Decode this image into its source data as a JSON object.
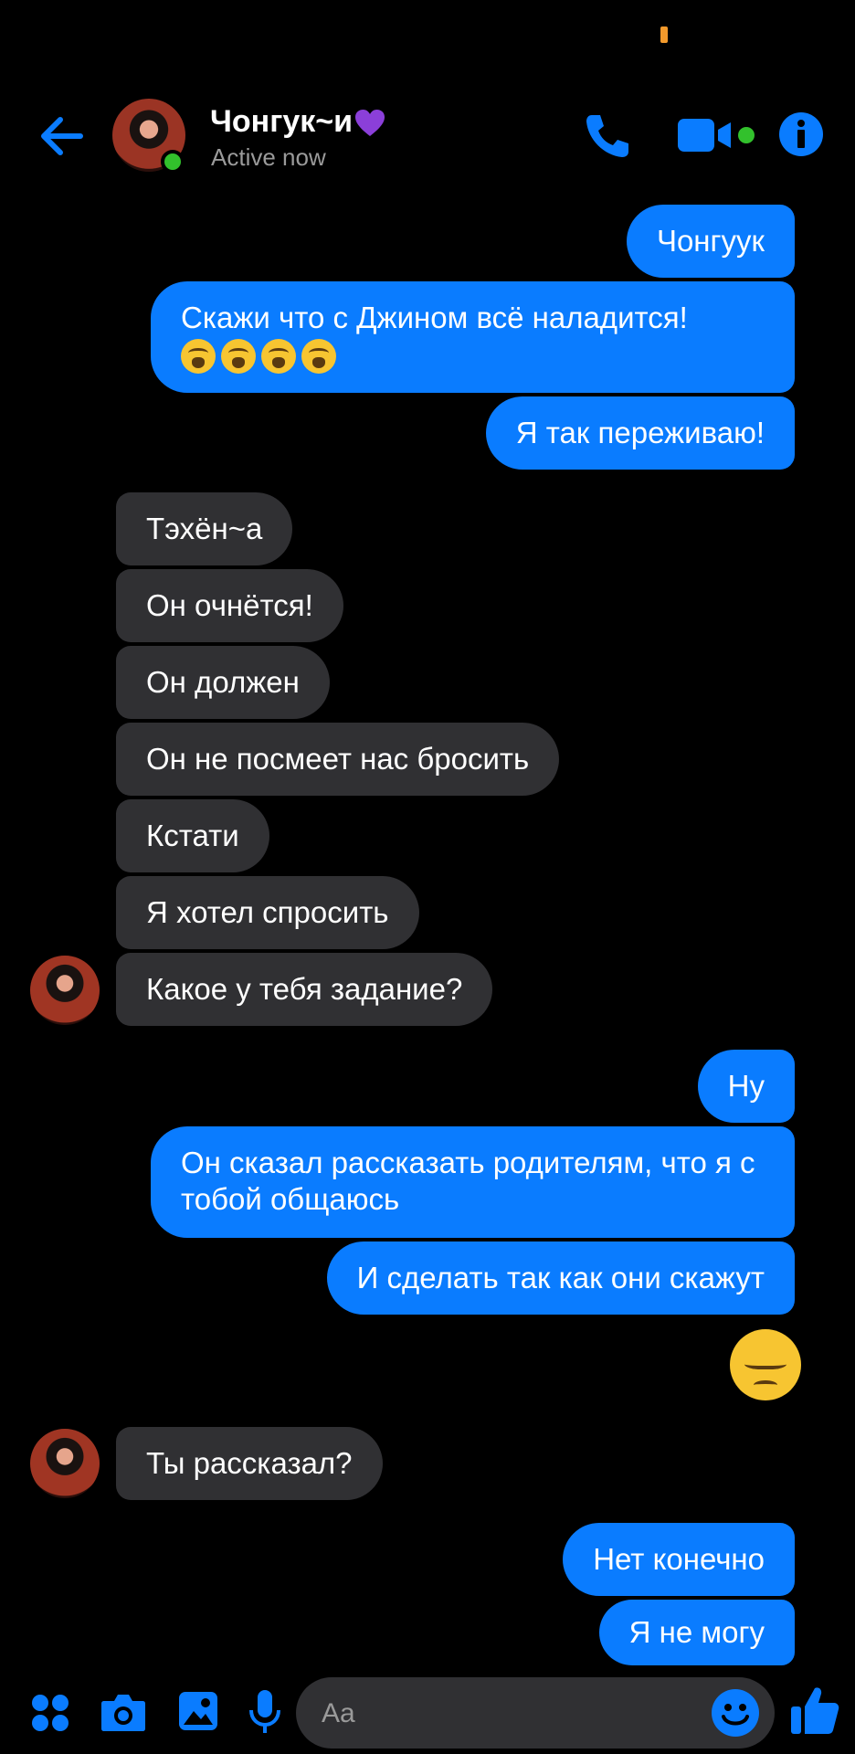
{
  "header": {
    "contact_name": "Чонгук~и",
    "status": "Active now"
  },
  "messages": [
    {
      "side": "out",
      "text": "Чонгуук"
    },
    {
      "side": "out",
      "text": "Скажи что с Джином всё наладится!"
    },
    {
      "side": "out",
      "text": "Я так переживаю!"
    },
    {
      "side": "in",
      "text": "Тэхён~а"
    },
    {
      "side": "in",
      "text": "Он очнётся!"
    },
    {
      "side": "in",
      "text": "Он должен"
    },
    {
      "side": "in",
      "text": "Он не посмеет нас бросить"
    },
    {
      "side": "in",
      "text": "Кстати"
    },
    {
      "side": "in",
      "text": "Я хотел спросить"
    },
    {
      "side": "in",
      "text": "Какое у тебя задание?"
    },
    {
      "side": "out",
      "text": "Ну"
    },
    {
      "side": "out",
      "text": "Он сказал рассказать родителям, что я с тобой общаюсь"
    },
    {
      "side": "out",
      "text": "И сделать так как они скажут"
    },
    {
      "side": "in",
      "text": "Ты рассказал?"
    },
    {
      "side": "out",
      "text": "Нет конечно"
    },
    {
      "side": "out",
      "text": "Я не могу"
    }
  ],
  "composer": {
    "placeholder": "Aa"
  },
  "colors": {
    "accent": "#0a7cff",
    "incoming_bubble": "#303033",
    "online": "#32c12c"
  },
  "icons": [
    "back-arrow-icon",
    "phone-icon",
    "video-icon",
    "info-icon",
    "apps-icon",
    "camera-icon",
    "gallery-icon",
    "mic-icon",
    "emoji-icon",
    "like-icon",
    "heart-icon",
    "crying-emoji",
    "pensive-emoji"
  ]
}
